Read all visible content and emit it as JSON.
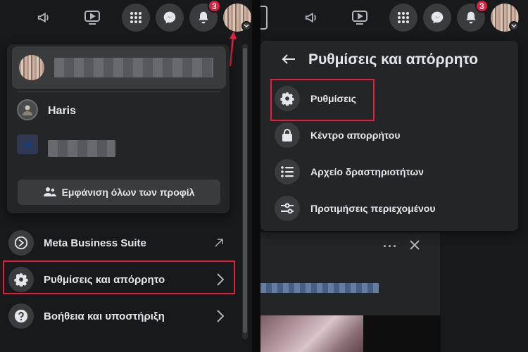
{
  "header": {
    "notification_count": "3"
  },
  "left_menu": {
    "profile_name": "Haris",
    "see_all_profiles": "Εμφάνιση όλων των προφίλ",
    "items": [
      {
        "label": "Meta Business Suite"
      },
      {
        "label": "Ρυθμίσεις και απόρρητο"
      },
      {
        "label": "Βοήθεια και υποστήριξη"
      }
    ]
  },
  "right_menu": {
    "title": "Ρυθμίσεις και απόρρητο",
    "items": [
      {
        "label": "Ρυθμίσεις"
      },
      {
        "label": "Κέντρο απορρήτου"
      },
      {
        "label": "Αρχείο δραστηριοτήτων"
      },
      {
        "label": "Προτιμήσεις περιεχομένου"
      }
    ]
  },
  "colors": {
    "background": "#18191a",
    "panel": "#242526",
    "button": "#3a3b3c",
    "text": "#e4e6eb",
    "highlight": "#e41e3f"
  }
}
